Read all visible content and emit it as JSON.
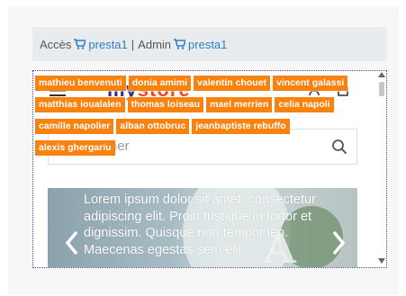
{
  "breadcrumb": {
    "label": "Accès",
    "link1": "presta1",
    "separator": "|",
    "admin_label": "Admin",
    "link2": "presta1"
  },
  "tags": [
    [
      "mathieu benvenuti",
      "donia amimi",
      "valentin chouet",
      "vincent galassi"
    ],
    [
      "matthias ioualalen",
      "thomas loiseau",
      "mael merrien",
      "celia napoli"
    ],
    [
      "camille napolier",
      "alban ottobruc",
      "jeanbaptiste rebuffo"
    ],
    [
      "alexis ghergariu"
    ]
  ],
  "site": {
    "logo_part1": "my",
    "logo_part2": "store",
    "search_placeholder": "Rechercher"
  },
  "carousel": {
    "caption_lines": [
      "Lorem ipsum dolor sit amet, consectetur",
      "adipiscing elit. Proin tristique in tortor et",
      "dignissim. Quisque non tempor leo.",
      "Maecenas egestas sem elit"
    ],
    "large_letter": "A"
  },
  "colors": {
    "tag_bg": "#f7820f",
    "link": "#2f7fc2",
    "breadcrumb_bg": "#e9ecef"
  }
}
